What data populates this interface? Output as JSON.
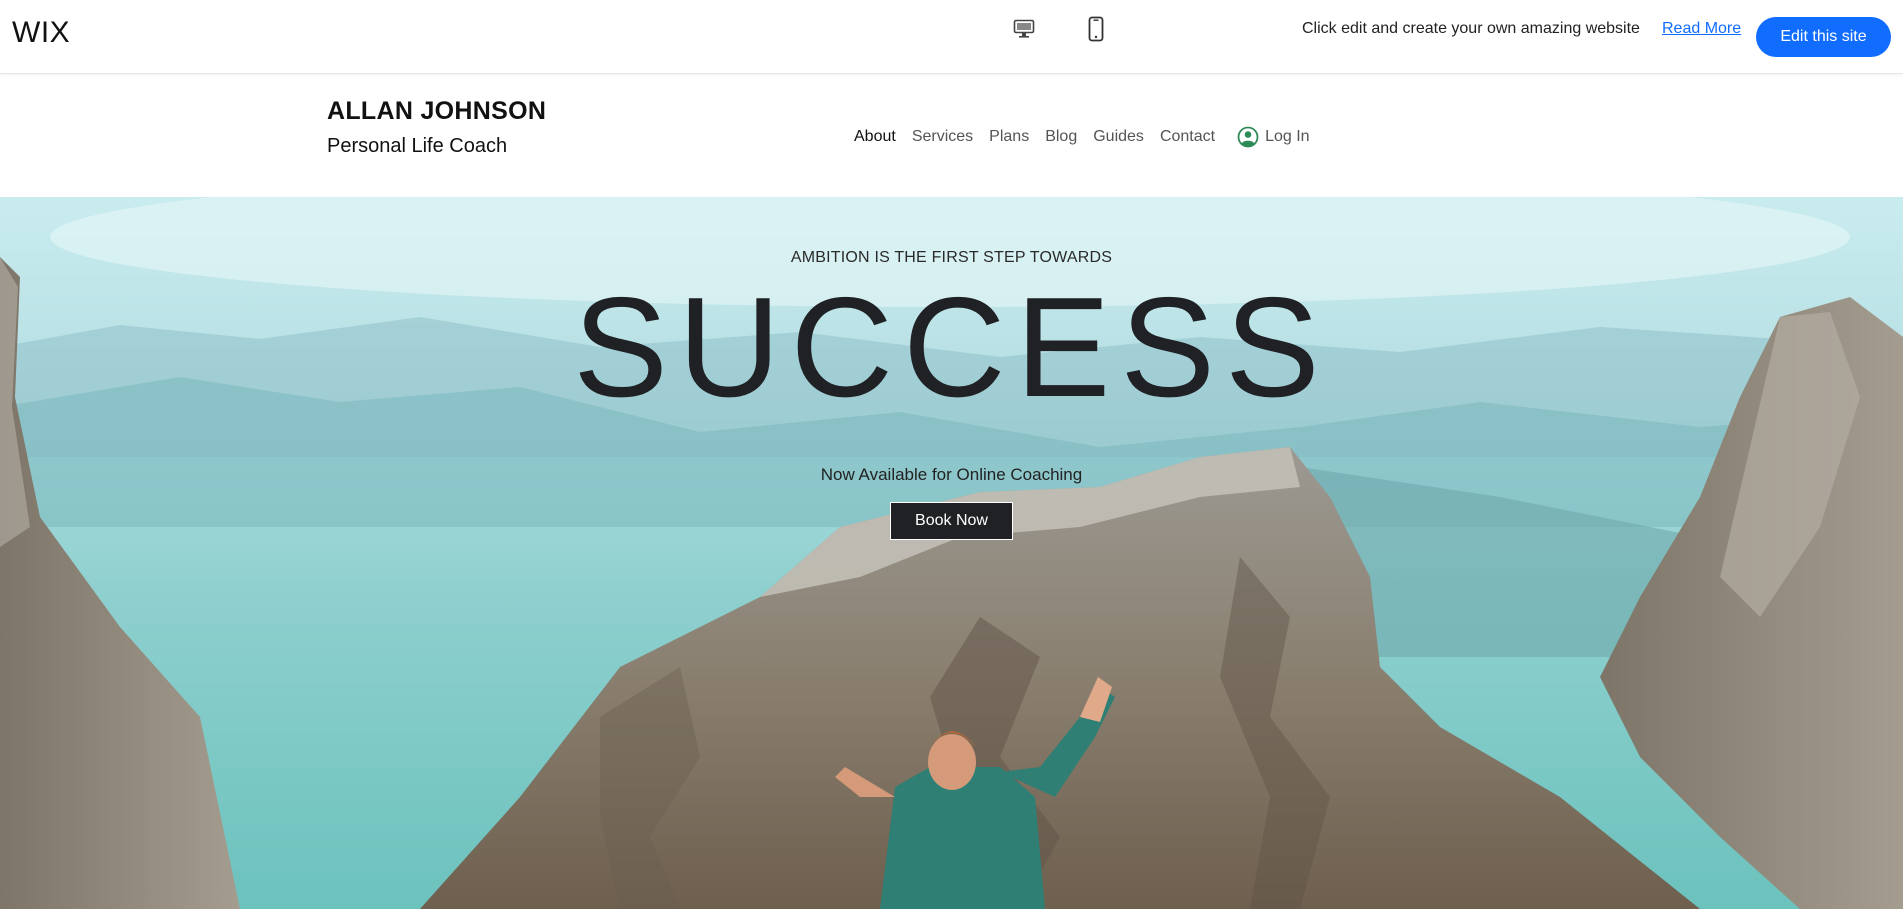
{
  "wix_bar": {
    "logo": "WIX",
    "devices": [
      {
        "name": "desktop",
        "icon": "desktop-icon"
      },
      {
        "name": "mobile",
        "icon": "mobile-icon"
      }
    ],
    "promo_text": "Click edit and create your own amazing website",
    "read_more_label": "Read More",
    "edit_button_label": "Edit this site",
    "accent_color": "#116dff"
  },
  "site_header": {
    "name": "ALLAN JOHNSON",
    "tagline": "Personal Life Coach",
    "nav": [
      {
        "label": "About",
        "active": true
      },
      {
        "label": "Services",
        "active": false
      },
      {
        "label": "Plans",
        "active": false
      },
      {
        "label": "Blog",
        "active": false
      },
      {
        "label": "Guides",
        "active": false
      },
      {
        "label": "Contact",
        "active": false
      }
    ],
    "login_label": "Log In",
    "login_icon": "user-circle-icon",
    "login_icon_color": "#2e8b57"
  },
  "hero": {
    "kicker": "AMBITION IS THE FIRST STEP TOWARDS",
    "title": "SUCCESS",
    "subtitle": "Now Available for Online Coaching",
    "cta_label": "Book Now",
    "cta_color": "#1f2124"
  }
}
